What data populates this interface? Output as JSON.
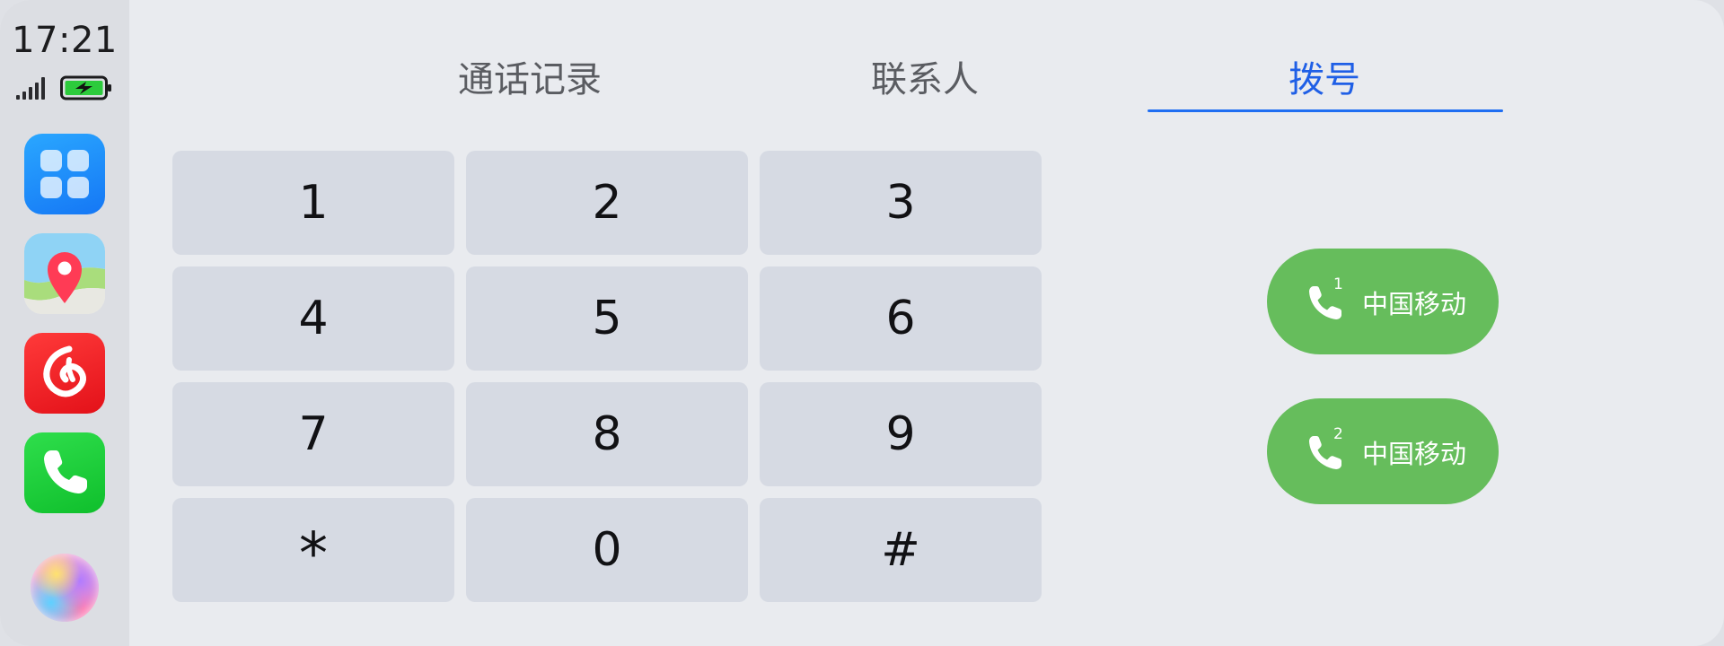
{
  "status_bar": {
    "time": "17:21",
    "signal_icon": "signal-bars-icon",
    "battery_icon": "battery-charging-icon"
  },
  "dock": {
    "apps": [
      {
        "name": "launcher",
        "icon": "app-grid-icon"
      },
      {
        "name": "maps",
        "icon": "map-pin-icon"
      },
      {
        "name": "music",
        "icon": "netease-music-icon"
      },
      {
        "name": "phone",
        "icon": "phone-icon"
      }
    ],
    "assistant_icon": "voice-assistant-icon"
  },
  "tabs": [
    {
      "label": "通话记录",
      "active": false
    },
    {
      "label": "联系人",
      "active": false
    },
    {
      "label": "拨号",
      "active": true
    }
  ],
  "keypad": {
    "keys": [
      "1",
      "2",
      "3",
      "4",
      "5",
      "6",
      "7",
      "8",
      "9",
      "*",
      "0",
      "#"
    ]
  },
  "call_buttons": [
    {
      "sim": "1",
      "carrier": "中国移动"
    },
    {
      "sim": "2",
      "carrier": "中国移动"
    }
  ],
  "colors": {
    "accent": "#1f6ef2",
    "call_green": "#66bd5c",
    "key_bg": "#d6dae3",
    "background": "#e9ebef"
  }
}
